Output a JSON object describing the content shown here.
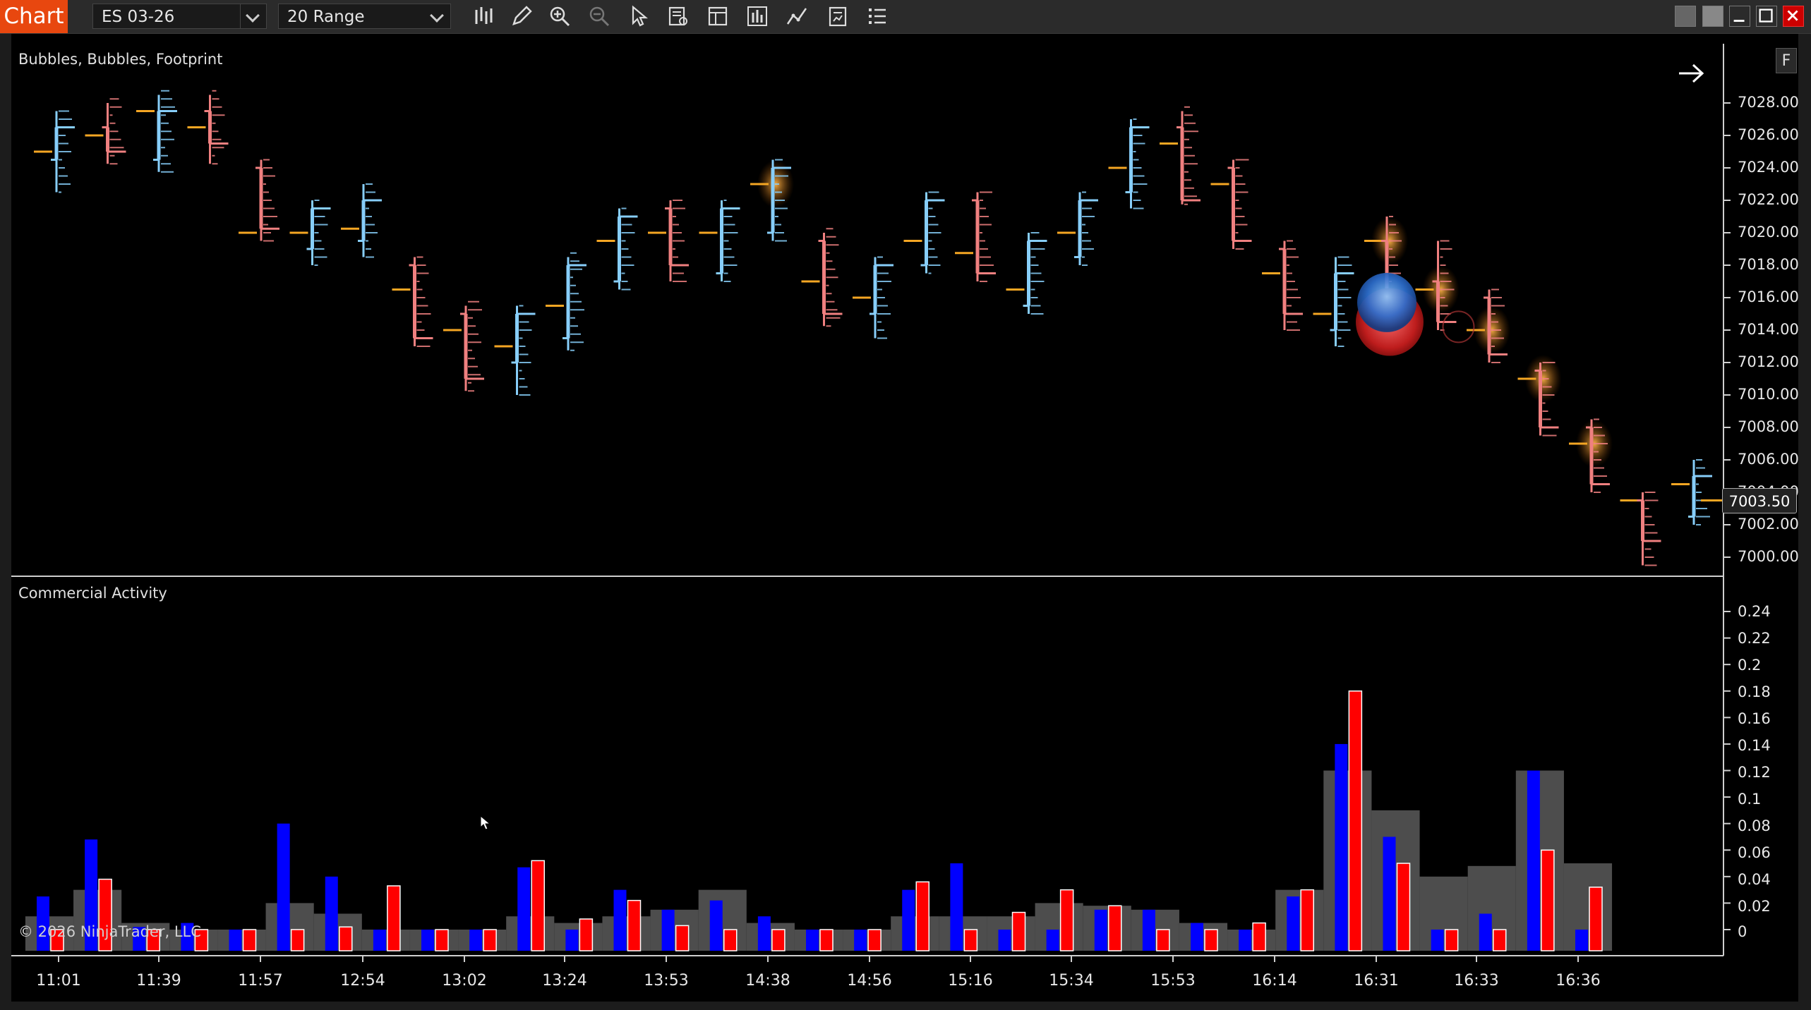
{
  "toolbar": {
    "tab_label": "Chart",
    "instrument": "ES 03-26",
    "interval": "20 Range",
    "tools": [
      "bar-type-icon",
      "pencil-icon",
      "zoom-in-icon",
      "zoom-out-icon",
      "pointer-icon",
      "data-box-icon",
      "properties-icon",
      "strategies-icon",
      "indicators-icon",
      "templates-icon",
      "more-menu-icon"
    ],
    "window_buttons": [
      "tile-icon",
      "tile-icon",
      "minimize-icon",
      "maximize-icon",
      "close-icon"
    ]
  },
  "price_panel": {
    "title": "Bubbles, Bubbles, Footprint",
    "last_price": "7003.50",
    "axis_ticks": [
      "7028.00",
      "7026.00",
      "7024.00",
      "7022.00",
      "7020.00",
      "7018.00",
      "7016.00",
      "7014.00",
      "7012.00",
      "7010.00",
      "7008.00",
      "7006.00",
      "7004.00",
      "7002.00",
      "7000.00"
    ],
    "f_button": "F"
  },
  "indicator_panel": {
    "title": "Commercial Activity",
    "axis_ticks": [
      "0.24",
      "0.22",
      "0.2",
      "0.18",
      "0.16",
      "0.14",
      "0.12",
      "0.1",
      "0.08",
      "0.06",
      "0.04",
      "0.02",
      "0"
    ]
  },
  "time_axis": [
    "11:01",
    "11:39",
    "11:57",
    "12:54",
    "13:02",
    "13:24",
    "13:53",
    "14:38",
    "14:56",
    "15:16",
    "15:34",
    "15:53",
    "16:14",
    "16:31",
    "16:33",
    "16:36"
  ],
  "copyright": "© 2026 NinjaTrader, LLC",
  "colors": {
    "up": "#87cefa",
    "down": "#f08080",
    "poc": "#f5a623",
    "buy": "#0000ff",
    "sell": "#ff0000",
    "accent": "#e8470f"
  },
  "chart_data": [
    {
      "type": "candlestick",
      "title": "Bubbles, Bubbles, Footprint",
      "ylim": [
        6999,
        7029
      ],
      "bars": [
        {
          "open": 7024.5,
          "close": 7026.5,
          "high": 7027.5,
          "low": 7022.5,
          "poc": 7025
        },
        {
          "open": 7026.5,
          "close": 7025,
          "high": 7028,
          "low": 7024.25,
          "poc": 7026
        },
        {
          "open": 7024.5,
          "close": 7027.5,
          "high": 7028.5,
          "low": 7023.75,
          "poc": 7027.5
        },
        {
          "open": 7027.5,
          "close": 7025.5,
          "high": 7028.5,
          "low": 7024.25,
          "poc": 7026.5
        },
        {
          "open": 7024,
          "close": 7020.25,
          "high": 7024.5,
          "low": 7019.5,
          "poc": 7020
        },
        {
          "open": 7019,
          "close": 7021.5,
          "high": 7022,
          "low": 7018,
          "poc": 7020
        },
        {
          "open": 7019.5,
          "close": 7022,
          "high": 7023,
          "low": 7018.5,
          "poc": 7020.25
        },
        {
          "open": 7018,
          "close": 7013.5,
          "high": 7018.5,
          "low": 7013,
          "poc": 7016.5
        },
        {
          "open": 7015,
          "close": 7011,
          "high": 7015.5,
          "low": 7010.25,
          "poc": 7014
        },
        {
          "open": 7012,
          "close": 7015,
          "high": 7015.5,
          "low": 7010,
          "poc": 7013
        },
        {
          "open": 7013.5,
          "close": 7018,
          "high": 7018.5,
          "low": 7012.75,
          "poc": 7015.5
        },
        {
          "open": 7017,
          "close": 7021,
          "high": 7021.5,
          "low": 7016.5,
          "poc": 7019.5
        },
        {
          "open": 7021.5,
          "close": 7018,
          "high": 7022,
          "low": 7017,
          "poc": 7020
        },
        {
          "open": 7017.5,
          "close": 7021.5,
          "high": 7022,
          "low": 7017,
          "poc": 7020
        },
        {
          "open": 7020,
          "close": 7024,
          "high": 7024.5,
          "low": 7019.5,
          "poc": 7023
        },
        {
          "open": 7019.5,
          "close": 7015,
          "high": 7020,
          "low": 7014.25,
          "poc": 7017
        },
        {
          "open": 7015,
          "close": 7018,
          "high": 7018.5,
          "low": 7013.5,
          "poc": 7016
        },
        {
          "open": 7018,
          "close": 7022,
          "high": 7022.5,
          "low": 7017.5,
          "poc": 7019.5
        },
        {
          "open": 7022,
          "close": 7017.5,
          "high": 7022.5,
          "low": 7017,
          "poc": 7018.75
        },
        {
          "open": 7015.5,
          "close": 7019.5,
          "high": 7020,
          "low": 7015,
          "poc": 7016.5
        },
        {
          "open": 7018.5,
          "close": 7022,
          "high": 7022.5,
          "low": 7018,
          "poc": 7020
        },
        {
          "open": 7022.5,
          "close": 7026.5,
          "high": 7027,
          "low": 7021.5,
          "poc": 7024
        },
        {
          "open": 7026.5,
          "close": 7022,
          "high": 7027.5,
          "low": 7021.75,
          "poc": 7025.5
        },
        {
          "open": 7024,
          "close": 7019.5,
          "high": 7024.5,
          "low": 7019,
          "poc": 7023
        },
        {
          "open": 7019,
          "close": 7015,
          "high": 7019.5,
          "low": 7014,
          "poc": 7017.5
        },
        {
          "open": 7014,
          "close": 7017.5,
          "high": 7018.5,
          "low": 7013,
          "poc": 7015
        },
        {
          "open": 7019.5,
          "close": 7016,
          "high": 7021,
          "low": 7015.5,
          "poc": 7019.5
        },
        {
          "open": 7017,
          "close": 7014.5,
          "high": 7019.5,
          "low": 7014,
          "poc": 7016.5
        },
        {
          "open": 7016,
          "close": 7012.5,
          "high": 7016.5,
          "low": 7012,
          "poc": 7014
        },
        {
          "open": 7011.5,
          "close": 7008,
          "high": 7012,
          "low": 7007.5,
          "poc": 7011
        },
        {
          "open": 7008,
          "close": 7004.5,
          "high": 7008.5,
          "low": 7004,
          "poc": 7007
        },
        {
          "open": 7003.5,
          "close": 7001,
          "high": 7004,
          "low": 6999.5,
          "poc": 7003.5
        },
        {
          "open": 7002.5,
          "close": 7005,
          "high": 7006,
          "low": 7002,
          "poc": 7004.5
        }
      ]
    },
    {
      "type": "bar",
      "title": "Commercial Activity",
      "ylim": [
        -0.02,
        0.25
      ],
      "series": [
        {
          "values": [
            0.025,
            0.068,
            0.002,
            0.005,
            -0.01,
            0.08,
            0.04,
            0.0,
            -0.01,
            -0.01,
            0.047,
            0.0,
            0.03,
            0.015,
            0.022,
            0.01,
            0.0,
            0.0,
            0.03,
            0.05,
            0.0,
            0.0,
            0.015,
            0.015,
            0.005,
            0.0,
            0.025,
            0.14,
            0.07,
            -0.01,
            0.012,
            0.12,
            0.0
          ]
        },
        {
          "values": [
            0.0,
            0.04,
            0.0,
            0.0,
            0.0,
            0.0,
            0.005,
            0.0,
            0.0,
            0.0,
            0.0,
            0.0,
            0.0,
            0.0,
            0.0,
            0.0,
            0.0,
            0.0,
            0.0,
            0.0,
            0.0,
            0.0,
            0.0,
            0.0,
            0.0,
            0.0,
            0.0,
            0.0,
            0.0,
            0.0,
            0.0,
            0.0,
            0.0
          ]
        },
        {
          "values": [
            0.0,
            0.0,
            0.0,
            0.0,
            0.0,
            0.0,
            0.0,
            0.0,
            0.0,
            0.0,
            0.0,
            0.0,
            0.0,
            0.0,
            0.0,
            0.0,
            0.0,
            0.0,
            0.0,
            0.0,
            0.0,
            0.0,
            0.0,
            0.0,
            0.0,
            0.0,
            0.0,
            0.0,
            0.0,
            0.0,
            0.0,
            0.0,
            0.0
          ]
        },
        {
          "values": [
            -0.01,
            0.038,
            -0.015,
            0.0,
            -0.01,
            0.0,
            0.002,
            0.033,
            -0.015,
            -0.015,
            0.052,
            0.008,
            0.022,
            0.003,
            0.0,
            0.0,
            0.0,
            0.0,
            0.036,
            -0.01,
            0.013,
            0.03,
            0.018,
            0.0,
            0.0,
            0.005,
            0.03,
            0.18,
            0.05,
            -0.01,
            0.0,
            0.06,
            0.032
          ]
        },
        {
          "values": [
            0.0,
            0.0,
            0.0,
            0.0,
            0.0,
            0.0,
            0.0,
            0.0,
            0.0,
            0.0,
            0.0,
            0.0,
            0.0,
            0.0,
            0.0,
            0.0,
            0.0,
            0.0,
            0.0,
            0.0,
            0.0,
            0.0,
            0.0,
            0.0,
            0.0,
            0.0,
            0.0,
            0.0,
            0.0,
            0.0,
            0.0,
            0.0,
            0.0
          ]
        },
        {
          "values": [
            0.01,
            0.03,
            0.005,
            0.0,
            0.0,
            0.02,
            0.012,
            0.0,
            0.0,
            0.0,
            0.01,
            0.005,
            0.01,
            0.015,
            0.03,
            0.005,
            0.0,
            0.0,
            0.01,
            0.01,
            0.01,
            0.02,
            0.018,
            0.015,
            0.005,
            0.0,
            0.03,
            0.12,
            0.09,
            0.04,
            0.048,
            0.12,
            0.05
          ]
        }
      ]
    }
  ]
}
